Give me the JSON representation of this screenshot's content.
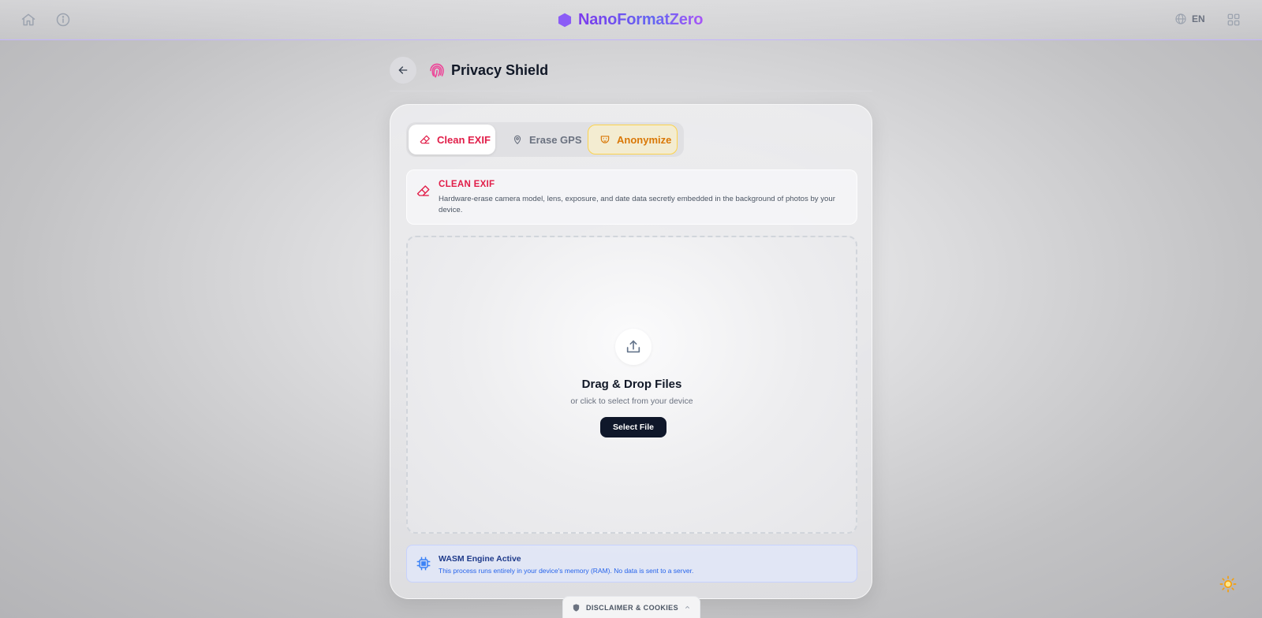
{
  "topbar": {
    "brand": "NanoFormatZero",
    "language": "EN",
    "icons": {
      "home": "home-icon",
      "info": "info-icon",
      "globe": "globe-icon",
      "apps": "grid-icon",
      "logo": "hexagon-logo-icon"
    },
    "brand_color": "#7c3aed"
  },
  "page": {
    "title": "Privacy Shield",
    "icon": "fingerprint-icon",
    "back_icon": "arrow-left-icon"
  },
  "tabs": [
    {
      "label": "Clean EXIF",
      "icon": "eraser-icon",
      "active": true,
      "color": "#e11d48"
    },
    {
      "label": "Erase GPS",
      "icon": "map-pin-icon",
      "active": false,
      "color": "#6b7280"
    },
    {
      "label": "Anonymize",
      "icon": "mask-icon",
      "active": false,
      "color": "#d97706"
    }
  ],
  "info": {
    "title": "CLEAN EXIF",
    "description": "Hardware-erase camera model, lens, exposure, and date data secretly embedded in the background of photos by your device."
  },
  "dropzone": {
    "title": "Drag & Drop Files",
    "subtitle": "or click to select from your device",
    "button": "Select File",
    "icon": "upload-icon"
  },
  "wasm": {
    "title": "WASM Engine Active",
    "description": "This process runs entirely in your device's memory (RAM). No data is sent to a server.",
    "icon": "cpu-chip-icon"
  },
  "footer": {
    "disclaimer": "DISCLAIMER & COOKIES",
    "icon": "shield-icon",
    "chevron": "chevron-up-icon",
    "theme_icon": "sun-icon"
  }
}
